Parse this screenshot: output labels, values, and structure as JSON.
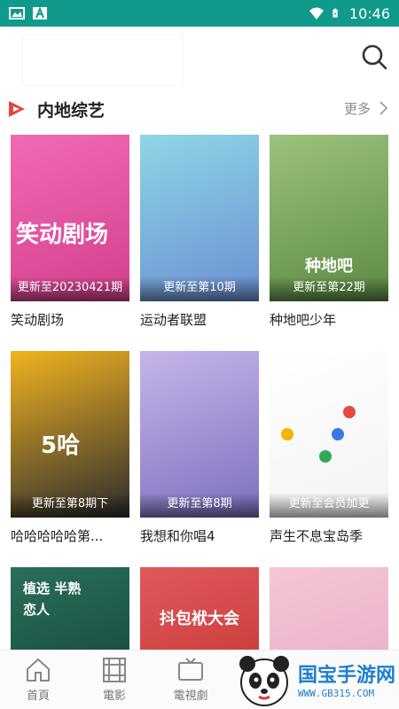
{
  "status_bar": {
    "time": "10:46"
  },
  "section": {
    "title": "内地综艺",
    "more": "更多"
  },
  "cards": [
    {
      "name": "笑动剧场",
      "episode": "更新至20230421期",
      "poster_text": "笑动剧场",
      "colors": [
        "#f06ab2",
        "#d43f8d"
      ]
    },
    {
      "name": "运动者联盟",
      "episode": "更新至第10期",
      "poster_text": "",
      "colors": [
        "#8fd6e6",
        "#6a8fd1"
      ]
    },
    {
      "name": "种地吧少年",
      "episode": "更新至第22期",
      "poster_text": "种地吧",
      "colors": [
        "#9cc27d",
        "#5c8a44"
      ]
    },
    {
      "name": "哈哈哈哈哈第...",
      "episode": "更新至第8期下",
      "poster_text": "5哈",
      "colors": [
        "#f2b21f",
        "#2c2d2f"
      ]
    },
    {
      "name": "我想和你唱4",
      "episode": "更新至第8期",
      "poster_text": "",
      "colors": [
        "#c6b5e8",
        "#7d6fbf"
      ]
    },
    {
      "name": "声生不息宝岛季",
      "episode": "更新至会员加更",
      "poster_text": "",
      "colors": [
        "#ffffff",
        "#f3f3f3"
      ]
    },
    {
      "name": "",
      "episode": "",
      "poster_text": "植选 半熟恋人",
      "colors": [
        "#2a6f5b",
        "#123d33"
      ]
    },
    {
      "name": "",
      "episode": "",
      "poster_text": "抖包袱大会",
      "colors": [
        "#e05a5a",
        "#c22e2e"
      ]
    },
    {
      "name": "",
      "episode": "",
      "poster_text": "",
      "colors": [
        "#f4c6d6",
        "#e7a7c4"
      ]
    }
  ],
  "bottom_nav": [
    {
      "label": "首頁",
      "icon": "home-icon"
    },
    {
      "label": "電影",
      "icon": "film-icon"
    },
    {
      "label": "電視劇",
      "icon": "tv-icon"
    }
  ],
  "watermark": {
    "brand": "国宝手游网",
    "url": "WWW.GB315.COM"
  }
}
